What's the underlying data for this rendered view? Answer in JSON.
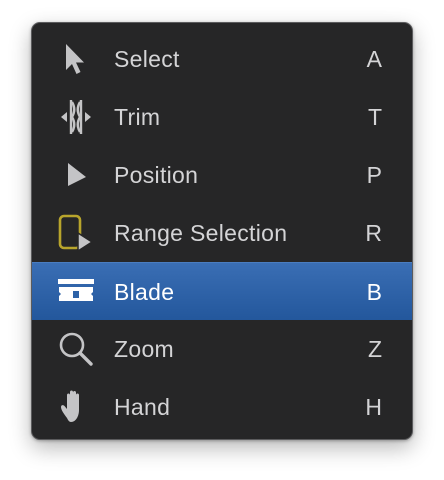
{
  "menu": {
    "items": [
      {
        "icon": "arrow-pointer-icon",
        "label": "Select",
        "shortcut": "A"
      },
      {
        "icon": "trim-icon",
        "label": "Trim",
        "shortcut": "T"
      },
      {
        "icon": "position-arrow-icon",
        "label": "Position",
        "shortcut": "P"
      },
      {
        "icon": "range-selection-icon",
        "label": "Range Selection",
        "shortcut": "R"
      },
      {
        "icon": "blade-icon",
        "label": "Blade",
        "shortcut": "B",
        "selected": true
      },
      {
        "icon": "magnifier-icon",
        "label": "Zoom",
        "shortcut": "Z"
      },
      {
        "icon": "hand-icon",
        "label": "Hand",
        "shortcut": "H"
      }
    ]
  },
  "colors": {
    "menu_background": "#262627",
    "selection": "#2d62a8",
    "text": "#d4d4d6",
    "range_selection_accent": "#b8a52c"
  }
}
